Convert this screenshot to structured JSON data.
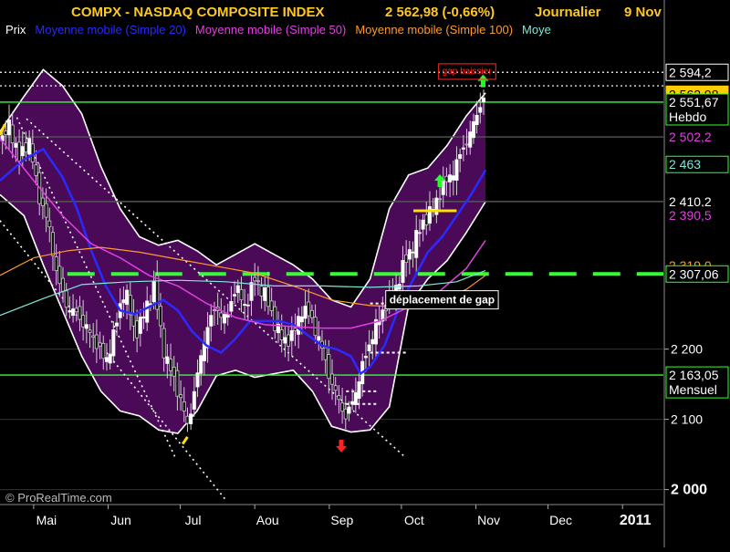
{
  "header": {
    "title": "COMPX - NASDAQ COMPOSITE INDEX",
    "last": "2 562,98 (-0,66%)",
    "period": "Journalier",
    "date": "9 Nov"
  },
  "legend": [
    {
      "label": "Prix",
      "color": "#ffffff"
    },
    {
      "label": "Moyenne mobile (Simple 20)",
      "color": "#2a2aff"
    },
    {
      "label": "Moyenne mobile (Simple 50)",
      "color": "#e040e0"
    },
    {
      "label": "Moyenne mobile (Simple 100)",
      "color": "#ff9a2a"
    },
    {
      "label": "Moye",
      "color": "#7fe8d8"
    }
  ],
  "watermark": "© ProRealTime.com",
  "colors": {
    "background": "#000000",
    "band_fill": "#4a0a58",
    "band_edge": "#ffffff",
    "candle_up": "#ffffff",
    "candle_down": "#c8c8c8",
    "sma20": "#2a2aff",
    "sma50": "#e040e0",
    "sma100": "#ff9a2a",
    "sma200": "#7fe8d8",
    "support": "#33ff33",
    "trend_dotted": "#ffffff",
    "axis_text": "#ffffff"
  },
  "chart_data": {
    "type": "line",
    "y_axis": {
      "range": [
        1980,
        2640
      ],
      "ticks": [
        {
          "value": 2100,
          "label": "2 100"
        },
        {
          "value": 2200,
          "label": "2 200"
        },
        {
          "value": 2000,
          "label": "2 000",
          "bold": true
        }
      ]
    },
    "x_axis": {
      "labels": [
        {
          "label": "Mai",
          "day": 0
        },
        {
          "label": "Jun",
          "day": 31
        },
        {
          "label": "Jul",
          "day": 61
        },
        {
          "label": "Aou",
          "day": 92
        },
        {
          "label": "Sep",
          "day": 123
        },
        {
          "label": "Oct",
          "day": 153
        },
        {
          "label": "Nov",
          "day": 184
        },
        {
          "label": "Dec",
          "day": 214
        },
        {
          "label": "2011",
          "day": 245,
          "bold": true
        }
      ],
      "range_days": [
        -14,
        262
      ]
    },
    "price_boxes": [
      {
        "value": 2594.2,
        "label": "2 594,2",
        "bg": "#000000",
        "fg": "#ffffff",
        "border": "#ffffff"
      },
      {
        "value": 2562.98,
        "label": "2 562,98",
        "bg": "#ffcc00",
        "fg": "#000000",
        "border": "#ffcc00"
      },
      {
        "value": 2551.67,
        "label": "2 551,67",
        "sub": "Hebdo",
        "bg": "#000000",
        "fg": "#ffffff",
        "border": "#33ff33"
      },
      {
        "value": 2502.2,
        "label": "2 502,2",
        "bg": "#000000",
        "fg": "#e040e0",
        "border": "#000000"
      },
      {
        "value": 2463,
        "label": "2 463",
        "bg": "#000000",
        "fg": "#7fe8d8",
        "border": "#33ff33"
      },
      {
        "value": 2410.2,
        "label": "2 410,2",
        "bg": "#000000",
        "fg": "#ffffff",
        "border": "#000000"
      },
      {
        "value": 2390.5,
        "label": "2 390,5",
        "bg": "#000000",
        "fg": "#e040e0",
        "border": "#000000"
      },
      {
        "value": 2319.0,
        "label": "2 319,0",
        "bg": "#000000",
        "fg": "#ff9a2a",
        "border": "#000000"
      },
      {
        "value": 2307.06,
        "label": "2 307,06",
        "bg": "#000000",
        "fg": "#ffffff",
        "border": "#33ff33"
      },
      {
        "value": 2163.05,
        "label": "2 163,05",
        "sub": "Mensuel",
        "bg": "#000000",
        "fg": "#ffffff",
        "border": "#33ff33"
      }
    ],
    "horizontal_lines": [
      {
        "value": 2551.67,
        "color": "#33ff33",
        "style": "solid",
        "from_day": -14
      },
      {
        "value": 2163.05,
        "color": "#33ff33",
        "style": "solid",
        "from_day": -14
      },
      {
        "value": 2307.06,
        "color": "#33ff33",
        "style": "dash",
        "from_day": 14
      },
      {
        "value": 2594.2,
        "color": "#dddddd",
        "style": "dot",
        "from_day": -14
      },
      {
        "value": 2575.0,
        "color": "#dddddd",
        "style": "dot",
        "from_day": -14
      },
      {
        "value": 2502.2,
        "color": "#555555",
        "style": "solid",
        "from_day": -14
      },
      {
        "value": 2410.2,
        "color": "#555555",
        "style": "solid",
        "from_day": -14
      }
    ],
    "trendlines": [
      {
        "from": [
          -7,
          2530
        ],
        "to": [
          59,
          2045
        ],
        "color": "#ffffff",
        "style": "dot"
      },
      {
        "from": [
          -14,
          2383
        ],
        "to": [
          80,
          1985
        ],
        "color": "#ffffff",
        "style": "dot"
      },
      {
        "from": [
          -3,
          2528
        ],
        "to": [
          154,
          2048
        ],
        "color": "#ffffff",
        "style": "dot"
      }
    ],
    "upper_band": [
      [
        -14,
        2510
      ],
      [
        -4,
        2560
      ],
      [
        4,
        2598
      ],
      [
        12,
        2575
      ],
      [
        20,
        2535
      ],
      [
        28,
        2460
      ],
      [
        36,
        2400
      ],
      [
        44,
        2360
      ],
      [
        52,
        2348
      ],
      [
        60,
        2355
      ],
      [
        68,
        2340
      ],
      [
        76,
        2320
      ],
      [
        84,
        2335
      ],
      [
        92,
        2350
      ],
      [
        100,
        2335
      ],
      [
        108,
        2320
      ],
      [
        116,
        2300
      ],
      [
        124,
        2270
      ],
      [
        132,
        2260
      ],
      [
        140,
        2300
      ],
      [
        148,
        2400
      ],
      [
        156,
        2448
      ],
      [
        164,
        2458
      ],
      [
        172,
        2490
      ],
      [
        180,
        2532
      ],
      [
        188,
        2565
      ]
    ],
    "lower_band": [
      [
        188,
        2410
      ],
      [
        180,
        2366
      ],
      [
        172,
        2326
      ],
      [
        164,
        2300
      ],
      [
        156,
        2262
      ],
      [
        148,
        2118
      ],
      [
        140,
        2085
      ],
      [
        132,
        2082
      ],
      [
        124,
        2090
      ],
      [
        116,
        2140
      ],
      [
        108,
        2170
      ],
      [
        100,
        2165
      ],
      [
        92,
        2160
      ],
      [
        84,
        2170
      ],
      [
        76,
        2162
      ],
      [
        68,
        2112
      ],
      [
        60,
        2080
      ],
      [
        52,
        2085
      ],
      [
        44,
        2105
      ],
      [
        36,
        2112
      ],
      [
        28,
        2140
      ],
      [
        20,
        2190
      ],
      [
        12,
        2255
      ],
      [
        4,
        2320
      ],
      [
        -4,
        2390
      ],
      [
        -14,
        2420
      ]
    ],
    "series": [
      {
        "name": "Moyenne mobile (Simple 20)",
        "color": "#2a2aff",
        "width": 2.5,
        "points": [
          [
            -14,
            2440
          ],
          [
            -4,
            2470
          ],
          [
            4,
            2485
          ],
          [
            12,
            2445
          ],
          [
            18,
            2400
          ],
          [
            24,
            2340
          ],
          [
            30,
            2290
          ],
          [
            36,
            2255
          ],
          [
            42,
            2250
          ],
          [
            48,
            2260
          ],
          [
            54,
            2270
          ],
          [
            60,
            2255
          ],
          [
            66,
            2225
          ],
          [
            72,
            2205
          ],
          [
            78,
            2195
          ],
          [
            84,
            2215
          ],
          [
            90,
            2240
          ],
          [
            96,
            2240
          ],
          [
            102,
            2240
          ],
          [
            108,
            2235
          ],
          [
            114,
            2220
          ],
          [
            120,
            2205
          ],
          [
            126,
            2200
          ],
          [
            132,
            2190
          ],
          [
            136,
            2165
          ],
          [
            140,
            2175
          ],
          [
            146,
            2205
          ],
          [
            152,
            2260
          ],
          [
            158,
            2300
          ],
          [
            164,
            2338
          ],
          [
            170,
            2360
          ],
          [
            176,
            2390
          ],
          [
            182,
            2420
          ],
          [
            188,
            2455
          ]
        ]
      },
      {
        "name": "Moyenne mobile (Simple 50)",
        "color": "#e040e0",
        "width": 1.5,
        "points": [
          [
            -14,
            2500
          ],
          [
            0,
            2440
          ],
          [
            12,
            2390
          ],
          [
            24,
            2350
          ],
          [
            36,
            2330
          ],
          [
            48,
            2305
          ],
          [
            60,
            2290
          ],
          [
            72,
            2265
          ],
          [
            84,
            2245
          ],
          [
            96,
            2235
          ],
          [
            108,
            2232
          ],
          [
            120,
            2230
          ],
          [
            132,
            2230
          ],
          [
            144,
            2240
          ],
          [
            156,
            2260
          ],
          [
            168,
            2280
          ],
          [
            180,
            2315
          ],
          [
            188,
            2355
          ]
        ]
      },
      {
        "name": "Moyenne mobile (Simple 100)",
        "color": "#ff9a2a",
        "width": 1.2,
        "points": [
          [
            -14,
            2305
          ],
          [
            0,
            2330
          ],
          [
            14,
            2340
          ],
          [
            28,
            2345
          ],
          [
            44,
            2338
          ],
          [
            60,
            2328
          ],
          [
            76,
            2318
          ],
          [
            92,
            2308
          ],
          [
            108,
            2290
          ],
          [
            124,
            2270
          ],
          [
            140,
            2262
          ],
          [
            156,
            2260
          ],
          [
            170,
            2270
          ],
          [
            180,
            2285
          ],
          [
            188,
            2305
          ]
        ]
      },
      {
        "name": "Moye",
        "color": "#7fe8d8",
        "width": 1.2,
        "points": [
          [
            -14,
            2248
          ],
          [
            4,
            2272
          ],
          [
            20,
            2292
          ],
          [
            40,
            2296
          ],
          [
            60,
            2298
          ],
          [
            80,
            2296
          ],
          [
            100,
            2290
          ],
          [
            120,
            2290
          ],
          [
            140,
            2288
          ],
          [
            160,
            2290
          ],
          [
            176,
            2296
          ],
          [
            188,
            2312
          ]
        ]
      }
    ],
    "price_path": [
      [
        -14,
        2490
      ],
      [
        -10,
        2520
      ],
      [
        -6,
        2470
      ],
      [
        -2,
        2500
      ],
      [
        2,
        2420
      ],
      [
        6,
        2380
      ],
      [
        10,
        2300
      ],
      [
        14,
        2260
      ],
      [
        18,
        2250
      ],
      [
        22,
        2230
      ],
      [
        26,
        2210
      ],
      [
        30,
        2180
      ],
      [
        34,
        2230
      ],
      [
        38,
        2290
      ],
      [
        42,
        2220
      ],
      [
        46,
        2250
      ],
      [
        50,
        2290
      ],
      [
        54,
        2200
      ],
      [
        58,
        2160
      ],
      [
        62,
        2120
      ],
      [
        64,
        2090
      ],
      [
        68,
        2160
      ],
      [
        72,
        2230
      ],
      [
        76,
        2260
      ],
      [
        80,
        2240
      ],
      [
        84,
        2290
      ],
      [
        88,
        2260
      ],
      [
        92,
        2300
      ],
      [
        96,
        2280
      ],
      [
        100,
        2240
      ],
      [
        104,
        2210
      ],
      [
        108,
        2220
      ],
      [
        112,
        2260
      ],
      [
        116,
        2240
      ],
      [
        120,
        2200
      ],
      [
        124,
        2150
      ],
      [
        128,
        2120
      ],
      [
        130,
        2100
      ],
      [
        134,
        2140
      ],
      [
        138,
        2190
      ],
      [
        142,
        2230
      ],
      [
        146,
        2260
      ],
      [
        150,
        2280
      ],
      [
        154,
        2320
      ],
      [
        158,
        2350
      ],
      [
        162,
        2380
      ],
      [
        166,
        2400
      ],
      [
        170,
        2430
      ],
      [
        174,
        2450
      ],
      [
        178,
        2480
      ],
      [
        182,
        2510
      ],
      [
        186,
        2550
      ],
      [
        188,
        2563
      ]
    ],
    "annotations": [
      {
        "text": "gap baissier",
        "day": 170,
        "value": 2592,
        "color": "#ff2a2a",
        "boxed": true,
        "border": "#ff2a2a",
        "size": 10
      },
      {
        "text": "déplacement de gap",
        "day": 148,
        "value": 2265,
        "color": "#ffffff",
        "boxed": true,
        "border": "#ffffff",
        "bg": "#000000",
        "size": 12,
        "bold": true
      }
    ],
    "arrows": [
      {
        "day": 187,
        "value": 2582,
        "dir": "up",
        "color": "#22ff22"
      },
      {
        "day": 169,
        "value": 2440,
        "dir": "up",
        "color": "#22ff22"
      },
      {
        "day": 128,
        "value": 2062,
        "dir": "down",
        "color": "#ff2222"
      }
    ],
    "yellow_marks": [
      {
        "from": [
          -14,
          2505
        ],
        "to": [
          -12,
          2520
        ]
      },
      {
        "from": [
          62,
          2065
        ],
        "to": [
          64,
          2075
        ]
      },
      {
        "from": [
          158,
          2397
        ],
        "to": [
          176,
          2397
        ]
      }
    ],
    "gap_dashes": [
      {
        "day_from": 140,
        "day_to": 155,
        "value": 2265
      },
      {
        "day_from": 140,
        "day_to": 155,
        "value": 2195
      },
      {
        "day_from": 130,
        "day_to": 143,
        "value": 2140
      },
      {
        "day_from": 130,
        "day_to": 143,
        "value": 2122
      }
    ]
  }
}
